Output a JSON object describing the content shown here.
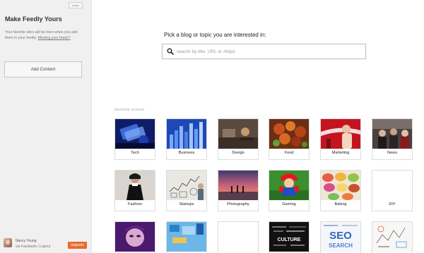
{
  "sidebar": {
    "unpin_label": "Unpin",
    "title": "Make Feedly Yours",
    "description": "Your favorite sites will be here when you add them to your feedly.",
    "missing_link": "Missing your feeds?",
    "add_button": "Add Content",
    "user": {
      "name": "Nancy Young",
      "via": "via Facebook / Logout",
      "upgrade_label": "Upgrade"
    }
  },
  "main": {
    "prompt": "Pick a blog or topic you are interested in:",
    "search_placeholder": "search by title, URL or #topic",
    "section_label": "EDITORS' CHOICE",
    "topics": [
      {
        "label": "Tech",
        "icon": "tech-image"
      },
      {
        "label": "Business",
        "icon": "business-image"
      },
      {
        "label": "Design",
        "icon": "design-image"
      },
      {
        "label": "Food",
        "icon": "food-image"
      },
      {
        "label": "Marketing",
        "icon": "marketing-image"
      },
      {
        "label": "News",
        "icon": "news-image"
      },
      {
        "label": "Fashion",
        "icon": "fashion-image"
      },
      {
        "label": "Startups",
        "icon": "startups-image"
      },
      {
        "label": "Photography",
        "icon": "photography-image"
      },
      {
        "label": "Gaming",
        "icon": "gaming-image"
      },
      {
        "label": "Baking",
        "icon": "baking-image"
      },
      {
        "label": "DIY",
        "icon": "diy-image"
      },
      {
        "label": "",
        "icon": "face-art-image"
      },
      {
        "label": "",
        "icon": "blue-abstract-image"
      },
      {
        "label": "",
        "icon": "blank-image"
      },
      {
        "label": "",
        "icon": "culture-words-image"
      },
      {
        "label": "",
        "icon": "seo-words-image"
      },
      {
        "label": "",
        "icon": "sketch-image"
      }
    ],
    "thumb_texts": {
      "culture": "CULTURE",
      "seo": "SEO",
      "search": "SEARCH"
    }
  }
}
